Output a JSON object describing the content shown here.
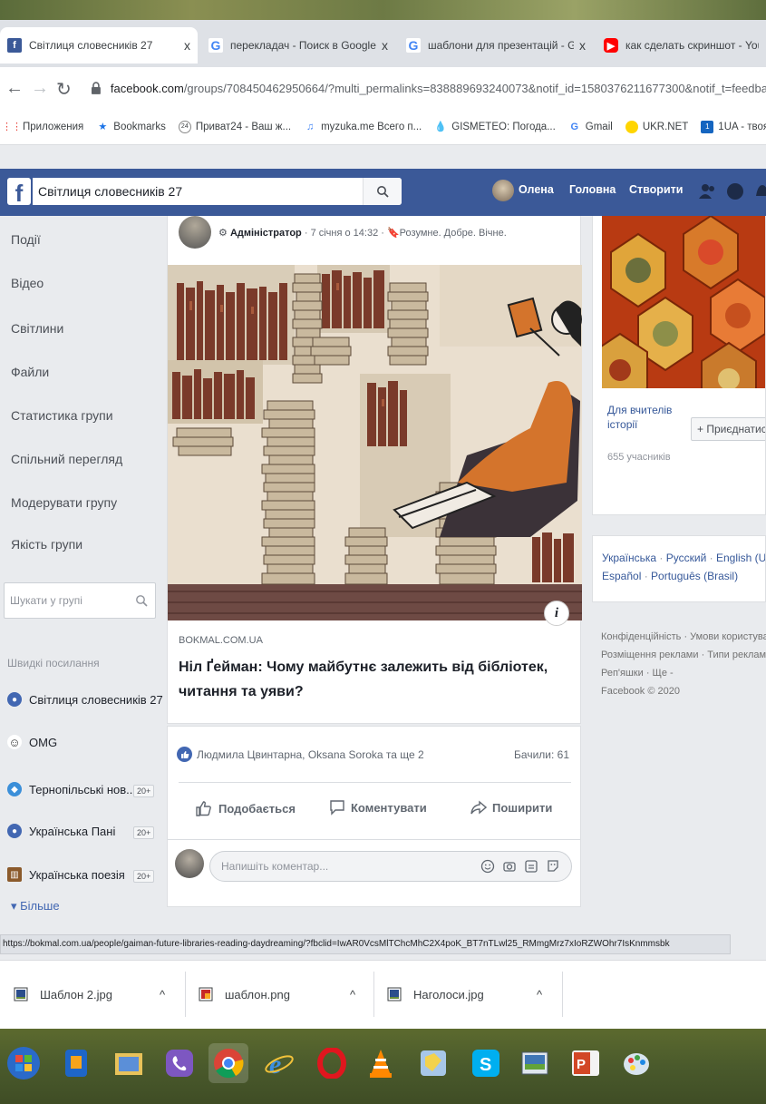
{
  "browser": {
    "tabs": [
      {
        "title": "Світлиця словесників 27",
        "favicon": "facebook-icon",
        "active": true
      },
      {
        "title": "перекладач - Поиск в Google",
        "favicon": "google-icon",
        "active": false
      },
      {
        "title": "шаблони для презентацій - Go",
        "favicon": "google-icon",
        "active": false
      },
      {
        "title": "как сделать скриншот - YouTube",
        "favicon": "youtube-icon",
        "active": false
      }
    ],
    "close_glyph": "x",
    "url_domain": "facebook.com",
    "url_path": "/groups/708450462950664/?multi_permalinks=838889693240073&notif_id=1580376211677300&notif_t=feedback",
    "bookmarks": [
      {
        "label": "Приложения",
        "icon": "apps-grid-icon"
      },
      {
        "label": "Bookmarks",
        "icon": "star-icon"
      },
      {
        "label": "Приват24 - Ваш ж...",
        "icon": "privat-icon"
      },
      {
        "label": "myzuka.me Всего п...",
        "icon": "music-icon"
      },
      {
        "label": "GISMETEO: Погода...",
        "icon": "weather-icon"
      },
      {
        "label": "Gmail",
        "icon": "google-icon"
      },
      {
        "label": "UKR.NET",
        "icon": "ukrnet-icon"
      },
      {
        "label": "1UA - твоя",
        "icon": "oneua-icon"
      }
    ]
  },
  "fb_header": {
    "search_value": "Світлиця словесників 27",
    "user_name": "Олена",
    "home_label": "Головна",
    "create_label": "Створити"
  },
  "left_nav": {
    "items": [
      "Події",
      "Відео",
      "Світлини",
      "Файли",
      "Статистика групи",
      "Спільний перегляд",
      "Модерувати групу",
      "Якість групи"
    ],
    "search_placeholder": "Шукати у групі",
    "quick_title": "Швидкі посилання",
    "quick_links": [
      {
        "label": "Світлиця словесників 27",
        "badge": ""
      },
      {
        "label": "OMG",
        "badge": ""
      },
      {
        "label": "Тернопільські нов...",
        "badge": "20+"
      },
      {
        "label": "Українська Пані",
        "badge": "20+"
      },
      {
        "label": "Українська поезія",
        "badge": "20+"
      }
    ],
    "more_label": "▾ Більше"
  },
  "post": {
    "meta_role": "Адміністратор",
    "meta_rest": " · 7 січня о 14:32 · 🔖Розумне. Добре. Вічне.",
    "link_domain": "BOKMAL.COM.UA",
    "link_title": "Ніл Ґейман: Чому майбутнє залежить від бібліотек, читання та уяви?",
    "info_glyph": "i",
    "reactions_text": "Людмила Цвинтарна, Oksana Soroka та ще 2",
    "views_text": "Бачили: 61",
    "like_label": "Подобається",
    "comment_label": "Коментувати",
    "share_label": "Поширити",
    "comment_placeholder": "Напишіть коментар..."
  },
  "right_col": {
    "suggest_name": "Для вчителів історії",
    "suggest_members": "655 учасників",
    "join_label": "+ Приєднатися",
    "languages_line1": [
      "Українська",
      "Русский",
      "English (US)"
    ],
    "languages_line2": [
      "Español",
      "Português (Brasil)"
    ],
    "footer_line1": "Конфіденційність · Умови користування",
    "footer_line2": "Розміщення реклами · Типи реклами",
    "footer_line3": "Реп'яшки · Ще -",
    "footer_line4": "Facebook © 2020"
  },
  "status_url": "https://bokmal.com.ua/people/gaiman-future-libraries-reading-daydreaming/?fbclid=IwAR0VcsMlTChcMhC2X4poK_BT7nTLwl25_RMmgMrz7xIoRZWOhr7IsKnmmsbk",
  "downloads": [
    {
      "name": "Шаблон 2.jpg",
      "icon": "image-file-icon"
    },
    {
      "name": "шаблон.png",
      "icon": "png-file-icon"
    },
    {
      "name": "Наголоси.jpg",
      "icon": "image-file-icon"
    }
  ],
  "colors": {
    "fb_blue": "#3b5998",
    "link_blue": "#365899",
    "page_bg": "#e9ebee"
  }
}
